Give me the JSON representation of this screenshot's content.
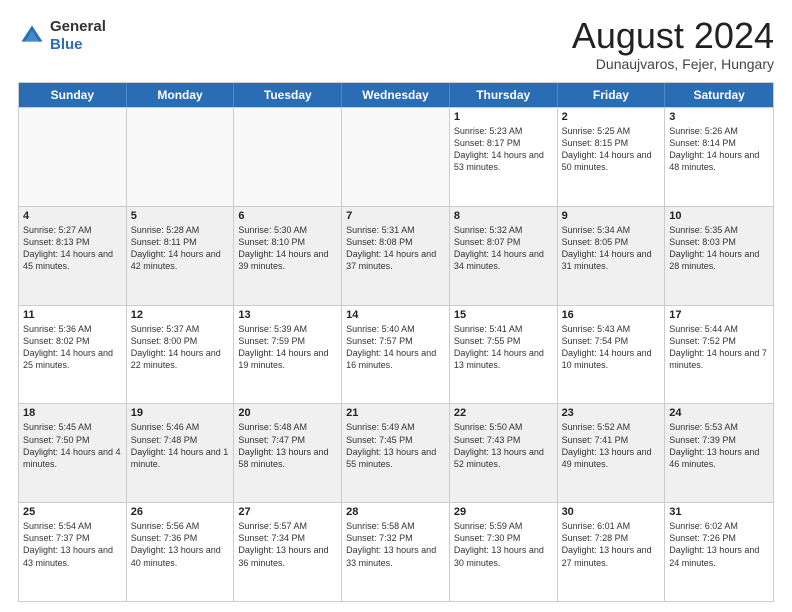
{
  "header": {
    "logo": {
      "general": "General",
      "blue": "Blue"
    },
    "title": "August 2024",
    "location": "Dunaujvaros, Fejer, Hungary"
  },
  "days_of_week": [
    "Sunday",
    "Monday",
    "Tuesday",
    "Wednesday",
    "Thursday",
    "Friday",
    "Saturday"
  ],
  "weeks": [
    [
      {
        "day": "",
        "empty": true
      },
      {
        "day": "",
        "empty": true
      },
      {
        "day": "",
        "empty": true
      },
      {
        "day": "",
        "empty": true
      },
      {
        "day": "1",
        "sunrise": "5:23 AM",
        "sunset": "8:17 PM",
        "daylight": "14 hours and 53 minutes."
      },
      {
        "day": "2",
        "sunrise": "5:25 AM",
        "sunset": "8:15 PM",
        "daylight": "14 hours and 50 minutes."
      },
      {
        "day": "3",
        "sunrise": "5:26 AM",
        "sunset": "8:14 PM",
        "daylight": "14 hours and 48 minutes."
      }
    ],
    [
      {
        "day": "4",
        "sunrise": "5:27 AM",
        "sunset": "8:13 PM",
        "daylight": "14 hours and 45 minutes."
      },
      {
        "day": "5",
        "sunrise": "5:28 AM",
        "sunset": "8:11 PM",
        "daylight": "14 hours and 42 minutes."
      },
      {
        "day": "6",
        "sunrise": "5:30 AM",
        "sunset": "8:10 PM",
        "daylight": "14 hours and 39 minutes."
      },
      {
        "day": "7",
        "sunrise": "5:31 AM",
        "sunset": "8:08 PM",
        "daylight": "14 hours and 37 minutes."
      },
      {
        "day": "8",
        "sunrise": "5:32 AM",
        "sunset": "8:07 PM",
        "daylight": "14 hours and 34 minutes."
      },
      {
        "day": "9",
        "sunrise": "5:34 AM",
        "sunset": "8:05 PM",
        "daylight": "14 hours and 31 minutes."
      },
      {
        "day": "10",
        "sunrise": "5:35 AM",
        "sunset": "8:03 PM",
        "daylight": "14 hours and 28 minutes."
      }
    ],
    [
      {
        "day": "11",
        "sunrise": "5:36 AM",
        "sunset": "8:02 PM",
        "daylight": "14 hours and 25 minutes."
      },
      {
        "day": "12",
        "sunrise": "5:37 AM",
        "sunset": "8:00 PM",
        "daylight": "14 hours and 22 minutes."
      },
      {
        "day": "13",
        "sunrise": "5:39 AM",
        "sunset": "7:59 PM",
        "daylight": "14 hours and 19 minutes."
      },
      {
        "day": "14",
        "sunrise": "5:40 AM",
        "sunset": "7:57 PM",
        "daylight": "14 hours and 16 minutes."
      },
      {
        "day": "15",
        "sunrise": "5:41 AM",
        "sunset": "7:55 PM",
        "daylight": "14 hours and 13 minutes."
      },
      {
        "day": "16",
        "sunrise": "5:43 AM",
        "sunset": "7:54 PM",
        "daylight": "14 hours and 10 minutes."
      },
      {
        "day": "17",
        "sunrise": "5:44 AM",
        "sunset": "7:52 PM",
        "daylight": "14 hours and 7 minutes."
      }
    ],
    [
      {
        "day": "18",
        "sunrise": "5:45 AM",
        "sunset": "7:50 PM",
        "daylight": "14 hours and 4 minutes."
      },
      {
        "day": "19",
        "sunrise": "5:46 AM",
        "sunset": "7:48 PM",
        "daylight": "14 hours and 1 minute."
      },
      {
        "day": "20",
        "sunrise": "5:48 AM",
        "sunset": "7:47 PM",
        "daylight": "13 hours and 58 minutes."
      },
      {
        "day": "21",
        "sunrise": "5:49 AM",
        "sunset": "7:45 PM",
        "daylight": "13 hours and 55 minutes."
      },
      {
        "day": "22",
        "sunrise": "5:50 AM",
        "sunset": "7:43 PM",
        "daylight": "13 hours and 52 minutes."
      },
      {
        "day": "23",
        "sunrise": "5:52 AM",
        "sunset": "7:41 PM",
        "daylight": "13 hours and 49 minutes."
      },
      {
        "day": "24",
        "sunrise": "5:53 AM",
        "sunset": "7:39 PM",
        "daylight": "13 hours and 46 minutes."
      }
    ],
    [
      {
        "day": "25",
        "sunrise": "5:54 AM",
        "sunset": "7:37 PM",
        "daylight": "13 hours and 43 minutes."
      },
      {
        "day": "26",
        "sunrise": "5:56 AM",
        "sunset": "7:36 PM",
        "daylight": "13 hours and 40 minutes."
      },
      {
        "day": "27",
        "sunrise": "5:57 AM",
        "sunset": "7:34 PM",
        "daylight": "13 hours and 36 minutes."
      },
      {
        "day": "28",
        "sunrise": "5:58 AM",
        "sunset": "7:32 PM",
        "daylight": "13 hours and 33 minutes."
      },
      {
        "day": "29",
        "sunrise": "5:59 AM",
        "sunset": "7:30 PM",
        "daylight": "13 hours and 30 minutes."
      },
      {
        "day": "30",
        "sunrise": "6:01 AM",
        "sunset": "7:28 PM",
        "daylight": "13 hours and 27 minutes."
      },
      {
        "day": "31",
        "sunrise": "6:02 AM",
        "sunset": "7:26 PM",
        "daylight": "13 hours and 24 minutes."
      }
    ]
  ],
  "labels": {
    "sunrise": "Sunrise:",
    "sunset": "Sunset:",
    "daylight": "Daylight:"
  }
}
